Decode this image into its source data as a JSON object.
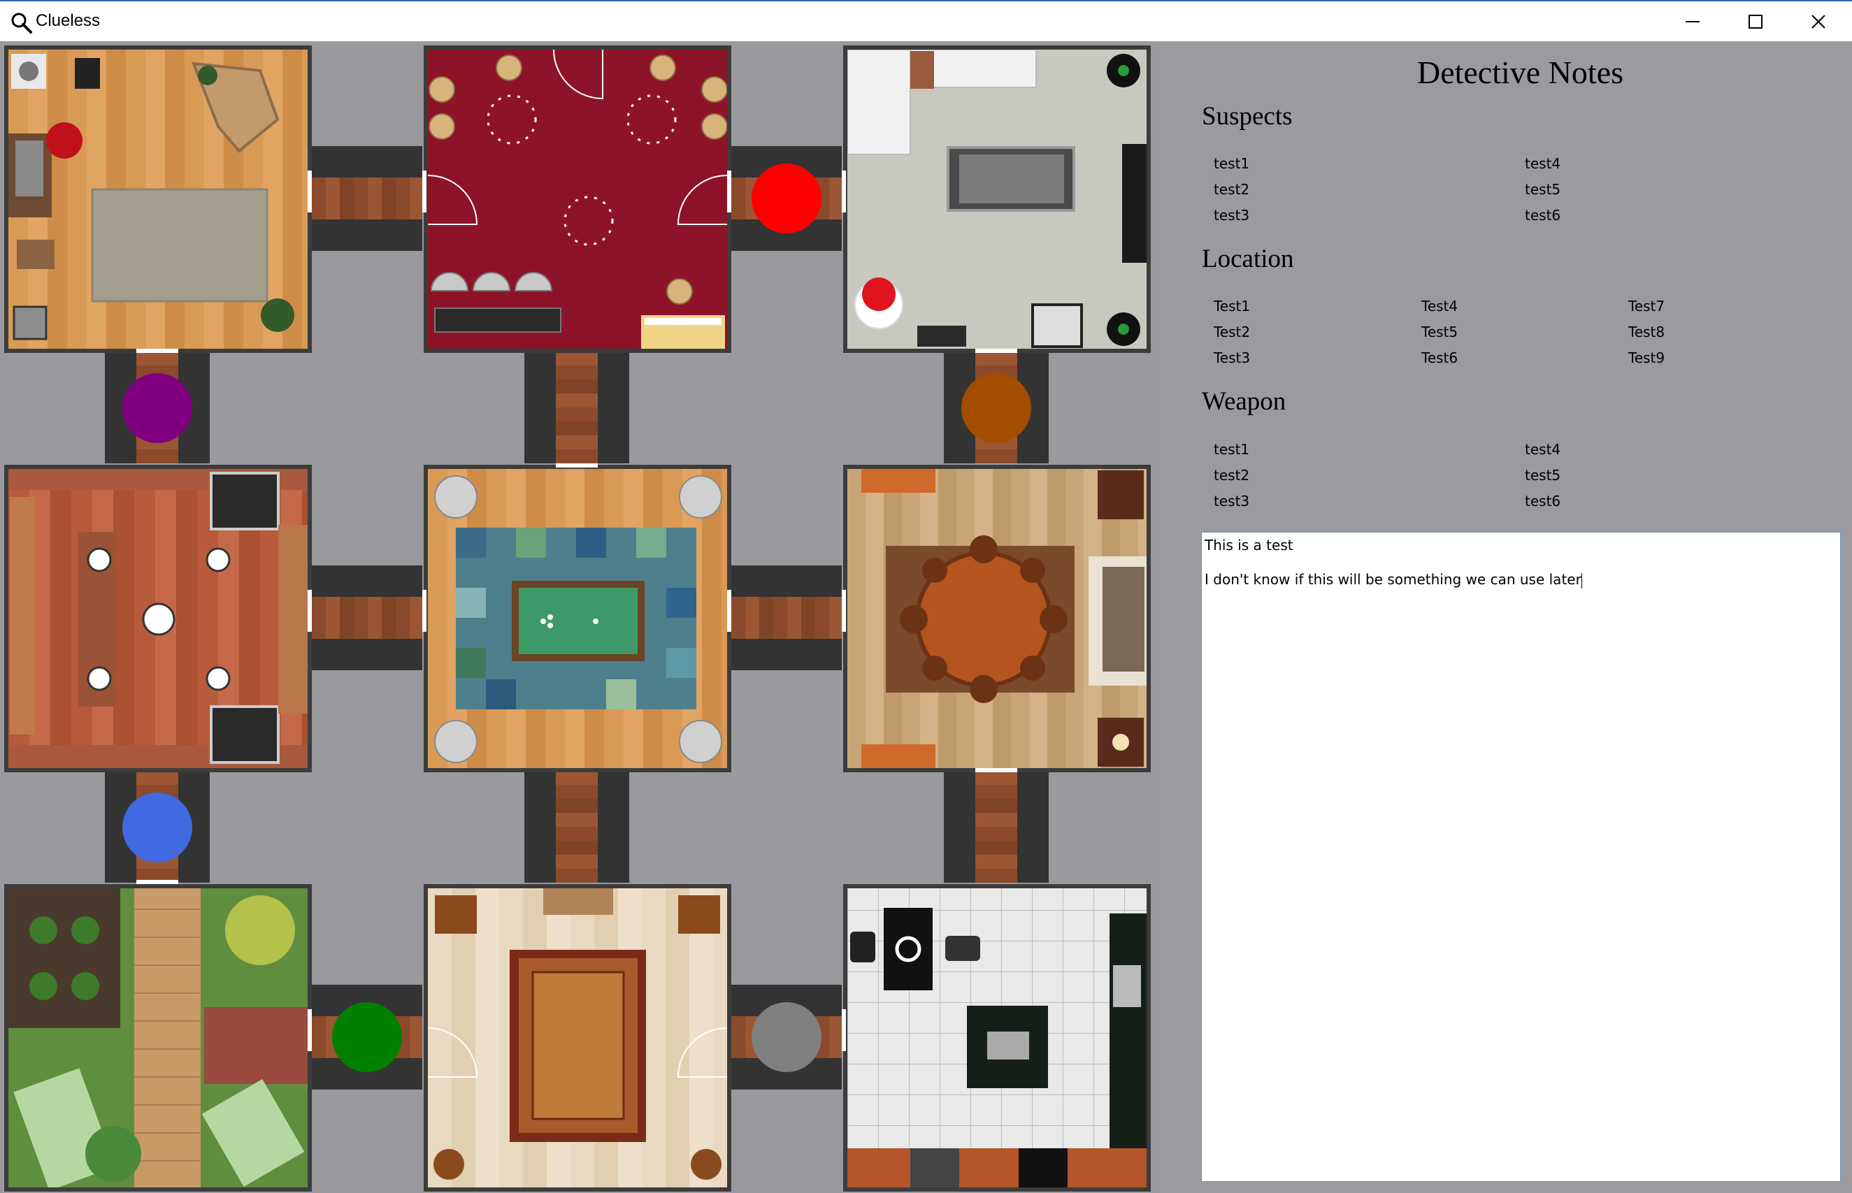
{
  "window": {
    "title": "Clueless",
    "icon": "magnifier-icon",
    "controls": [
      "minimize-icon",
      "maximize-icon",
      "close-icon"
    ]
  },
  "board": {
    "tokens": [
      {
        "name": "red",
        "color": "#ff0000"
      },
      {
        "name": "purple",
        "color": "#800080"
      },
      {
        "name": "orange",
        "color": "#a44c00"
      },
      {
        "name": "blue",
        "color": "#4169e1"
      },
      {
        "name": "green",
        "color": "#008000"
      },
      {
        "name": "grey",
        "color": "#808080"
      }
    ]
  },
  "notes": {
    "title": "Detective Notes",
    "suspects": {
      "heading": "Suspects",
      "items": [
        "test1",
        "test2",
        "test3",
        "test4",
        "test5",
        "test6"
      ]
    },
    "location": {
      "heading": "Location",
      "items": [
        "Test1",
        "Test2",
        "Test3",
        "Test4",
        "Test5",
        "Test6",
        "Test7",
        "Test8",
        "Test9"
      ]
    },
    "weapon": {
      "heading": "Weapon",
      "items": [
        "test1",
        "test2",
        "test3",
        "test4",
        "test5",
        "test6"
      ]
    },
    "notepad": {
      "line1": "This is a test",
      "line2": "I don't know if this will be something we can use later"
    }
  }
}
